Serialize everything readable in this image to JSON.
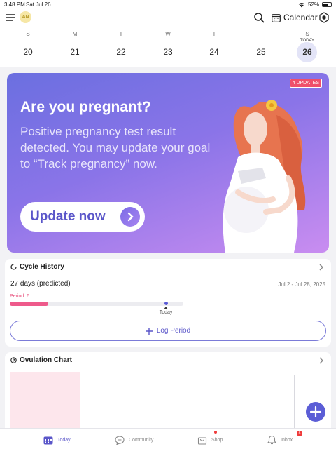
{
  "status_bar": {
    "time": "3:48 PM",
    "date": "Sat Jul 26",
    "battery": "52%"
  },
  "top_bar": {
    "avatar_initials": "AN",
    "calendar_label": "Calendar"
  },
  "week": {
    "today_label": "TODAY",
    "days": [
      {
        "dow": "S",
        "num": "20"
      },
      {
        "dow": "M",
        "num": "21"
      },
      {
        "dow": "T",
        "num": "22"
      },
      {
        "dow": "W",
        "num": "23"
      },
      {
        "dow": "T",
        "num": "24"
      },
      {
        "dow": "F",
        "num": "25"
      },
      {
        "dow": "S",
        "num": "26"
      }
    ]
  },
  "banner": {
    "badge": "4 UPDATES",
    "title": "Are you pregnant?",
    "message": "Positive pregnancy test result detected. You may update your goal to “Track pregnancy” now.",
    "button_label": "Update now"
  },
  "cycle_history": {
    "title": "Cycle History",
    "cycle_length": "27 days (predicted)",
    "date_range": "Jul 2 - Jul 28, 2025",
    "period_label": "Period: 6",
    "period_progress": 0.22,
    "today_position": 0.9,
    "today_label": "Today",
    "log_button": "Log Period"
  },
  "ovulation": {
    "title": "Ovulation Chart"
  },
  "tabs": [
    {
      "label": "Today",
      "icon": "calendar-icon",
      "active": true
    },
    {
      "label": "Community",
      "icon": "chat-bubble-icon"
    },
    {
      "label": "Shop",
      "icon": "shopping-bag-icon",
      "badge_dot": true
    },
    {
      "label": "Inbox",
      "icon": "bell-icon",
      "badge_count": "6"
    }
  ],
  "colors": {
    "accent": "#5a56c9",
    "period": "#ee5a8b",
    "banner_start": "#6b6fe0",
    "banner_end": "#c98df0"
  }
}
